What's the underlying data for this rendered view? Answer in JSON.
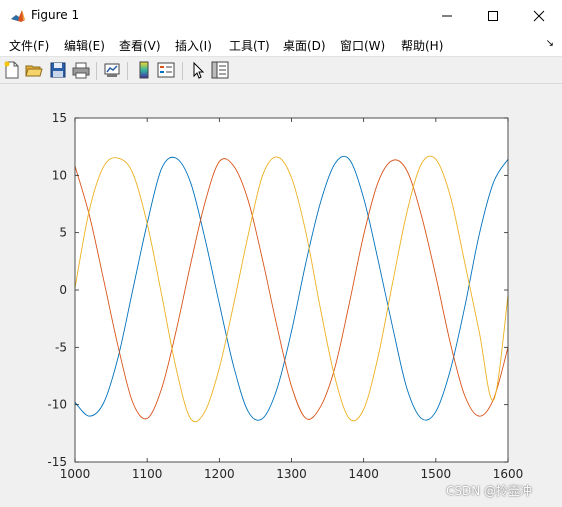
{
  "window": {
    "title": "Figure 1"
  },
  "menu": {
    "items": [
      "文件(F)",
      "编辑(E)",
      "查看(V)",
      "插入(I)",
      "工具(T)",
      "桌面(D)",
      "窗口(W)",
      "帮助(H)"
    ]
  },
  "toolbar": {
    "icons": [
      "new-figure-icon",
      "open-file-icon",
      "save-icon",
      "print-icon",
      "link-plot-icon",
      "colorbar-icon",
      "legend-icon",
      "edit-plot-arrow-icon",
      "property-inspector-icon"
    ]
  },
  "watermark": "CSDN @拎壶冲",
  "colors": {
    "series1": "#0072BD",
    "series2": "#D95319",
    "series3": "#EDB120"
  },
  "chart_data": {
    "type": "line",
    "title": "",
    "xlabel": "",
    "ylabel": "",
    "xlim": [
      1000,
      1600
    ],
    "ylim": [
      -15,
      15
    ],
    "xticks": [
      1000,
      1100,
      1200,
      1300,
      1400,
      1500,
      1600
    ],
    "yticks": [
      -15,
      -10,
      -5,
      0,
      5,
      10,
      15
    ],
    "grid": false,
    "legend": "none",
    "series": [
      {
        "x": [
          1000,
          1020,
          1040,
          1060,
          1080,
          1100,
          1120,
          1140,
          1160,
          1180,
          1200,
          1220,
          1240,
          1260,
          1280,
          1300,
          1320,
          1340,
          1360,
          1380,
          1400,
          1420,
          1440,
          1460,
          1480,
          1500,
          1520,
          1540,
          1560,
          1580,
          1600
        ],
        "y": [
          -9.8,
          -11.0,
          -9.8,
          -5.8,
          0.0,
          5.8,
          10.6,
          11.5,
          9.4,
          4.5,
          -1.2,
          -6.7,
          -10.6,
          -11.2,
          -8.6,
          -3.6,
          2.4,
          7.6,
          11.0,
          11.4,
          8.0,
          2.6,
          -3.2,
          -8.6,
          -11.2,
          -10.6,
          -7.0,
          -1.5,
          4.8,
          9.4,
          11.4
        ]
      },
      {
        "x": [
          1000,
          1020,
          1040,
          1060,
          1080,
          1100,
          1120,
          1140,
          1160,
          1180,
          1200,
          1220,
          1240,
          1260,
          1280,
          1300,
          1320,
          1340,
          1360,
          1380,
          1400,
          1420,
          1440,
          1460,
          1480,
          1500,
          1520,
          1540,
          1560,
          1580,
          1600
        ],
        "y": [
          10.8,
          6.5,
          0.8,
          -5.0,
          -9.8,
          -11.2,
          -8.6,
          -3.6,
          2.2,
          7.6,
          11.2,
          10.8,
          7.8,
          2.6,
          -3.2,
          -8.4,
          -11.2,
          -10.2,
          -6.8,
          -1.2,
          4.8,
          9.4,
          11.3,
          10.4,
          6.5,
          1.2,
          -4.6,
          -9.2,
          -11.0,
          -9.5,
          -5.0
        ]
      },
      {
        "x": [
          1000,
          1020,
          1040,
          1060,
          1080,
          1100,
          1120,
          1140,
          1160,
          1180,
          1200,
          1220,
          1240,
          1260,
          1280,
          1300,
          1320,
          1340,
          1360,
          1380,
          1400,
          1420,
          1440,
          1460,
          1480,
          1500,
          1520,
          1540,
          1560,
          1580,
          1600
        ],
        "y": [
          0.2,
          7.0,
          10.8,
          11.5,
          10.2,
          5.8,
          -0.4,
          -6.8,
          -11.2,
          -10.6,
          -6.8,
          -1.2,
          4.8,
          10.0,
          11.6,
          9.8,
          5.0,
          -1.6,
          -7.6,
          -11.2,
          -10.4,
          -5.8,
          0.6,
          6.8,
          11.0,
          11.4,
          8.2,
          2.4,
          -3.6,
          -9.6,
          -0.5
        ]
      }
    ]
  }
}
